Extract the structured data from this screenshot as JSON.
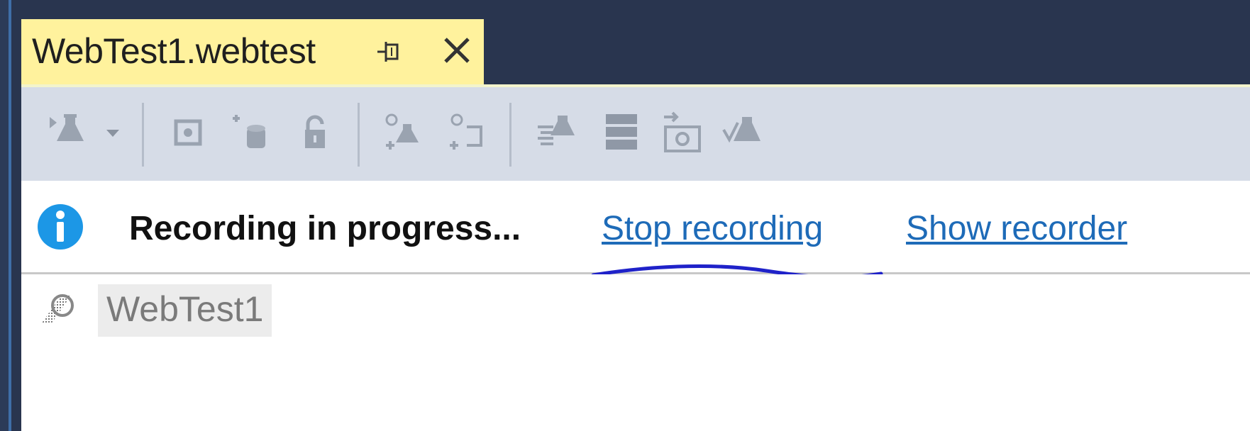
{
  "tab": {
    "title": "WebTest1.webtest",
    "pin_icon": "pin-icon",
    "close_icon": "close-icon"
  },
  "toolbar": {
    "icons": [
      "run-test-icon",
      "dropdown-arrow-icon",
      "record-icon",
      "add-data-source-icon",
      "lock-icon",
      "add-web-request-icon",
      "add-loop-icon",
      "parameterize-icon",
      "server-icon",
      "screenshot-icon",
      "add-validation-icon"
    ]
  },
  "infobar": {
    "icon": "info-icon",
    "message": "Recording in progress...",
    "stop_link": "Stop recording",
    "show_link": "Show recorder",
    "accent_color": "#1e6bb8"
  },
  "tree": {
    "root_icon": "web-test-icon",
    "root_label": "WebTest1"
  },
  "colors": {
    "tab_bg": "#fff29d",
    "frame_bg": "#29354f",
    "toolbar_bg": "#d6dce7",
    "annotation": "#1f22c9"
  }
}
